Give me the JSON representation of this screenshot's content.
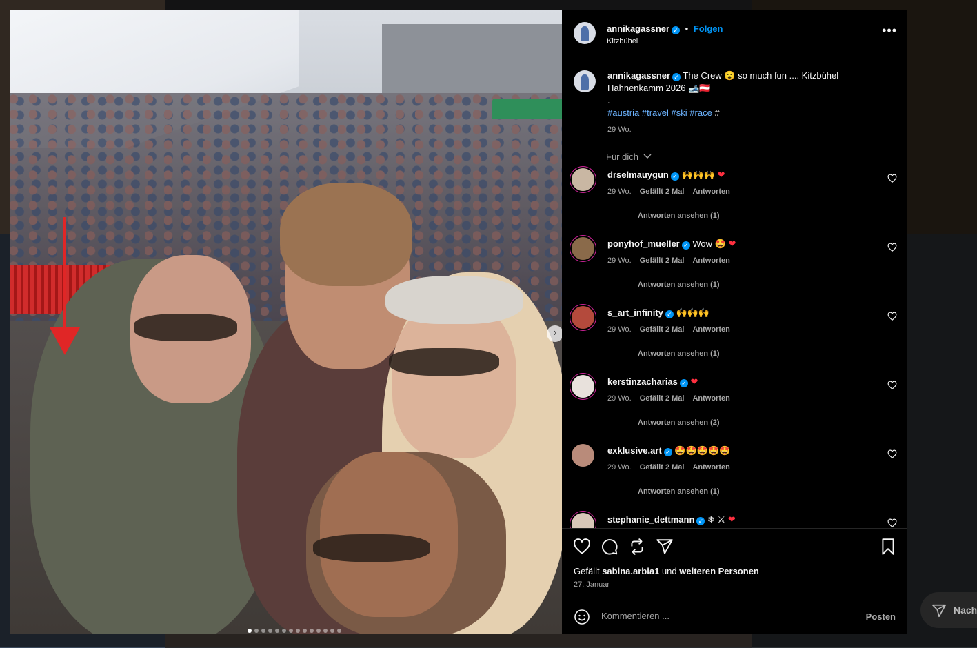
{
  "post": {
    "author": "annikagassner",
    "follow_label": "Folgen",
    "location": "Kitzbühel",
    "more_label": "•••",
    "caption_text": "The Crew 😮 so much fun .... Kitzbühel Hahnenkamm 2026 🎿🇦🇹",
    "caption_dot": ".",
    "hashtags": [
      "#austria",
      "#travel",
      "#ski",
      "#race",
      "#"
    ],
    "caption_time": "29 Wo.",
    "fuer_dich": "Für dich",
    "likes_prefix": "Gefällt",
    "likes_user": "sabina.arbia1",
    "likes_middle": "und",
    "likes_suffix": "weiteren Personen",
    "date": "27. Januar",
    "carousel_count": 14,
    "carousel_active": 0,
    "next_arrow": "›"
  },
  "comments": [
    {
      "user": "drselmauygun",
      "text": "🙌🙌🙌",
      "heart": "❤",
      "time": "29 Wo.",
      "likes": "Gefällt 2 Mal",
      "reply": "Antworten",
      "view_replies": "Antworten ansehen (1)"
    },
    {
      "user": "ponyhof_mueller",
      "text": "Wow 🤩",
      "heart": "❤",
      "time": "29 Wo.",
      "likes": "Gefällt 2 Mal",
      "reply": "Antworten",
      "view_replies": "Antworten ansehen (1)"
    },
    {
      "user": "s_art_infinity",
      "text": "🙌🙌🙌",
      "heart": "",
      "time": "29 Wo.",
      "likes": "Gefällt 2 Mal",
      "reply": "Antworten",
      "view_replies": "Antworten ansehen (1)"
    },
    {
      "user": "kerstinzacharias",
      "text": "",
      "heart": "❤",
      "time": "29 Wo.",
      "likes": "Gefällt 2 Mal",
      "reply": "Antworten",
      "view_replies": "Antworten ansehen (2)"
    },
    {
      "user": "exklusive.art",
      "text": "🤩🤩🤩🤩🤩",
      "heart": "",
      "time": "29 Wo.",
      "likes": "Gefällt 2 Mal",
      "reply": "Antworten",
      "view_replies": "Antworten ansehen (1)"
    },
    {
      "user": "stephanie_dettmann",
      "text": "❄ ⚔",
      "heart": "❤",
      "time": "",
      "likes": "",
      "reply": "",
      "view_replies": ""
    }
  ],
  "comment_box": {
    "placeholder": "Kommentieren ...",
    "post_label": "Posten"
  },
  "side_next_label": "Nach",
  "colors": {
    "accent": "#0095f6",
    "heart": "#ff3040",
    "arrow": "#e02626",
    "panel_bg": "#000000"
  }
}
